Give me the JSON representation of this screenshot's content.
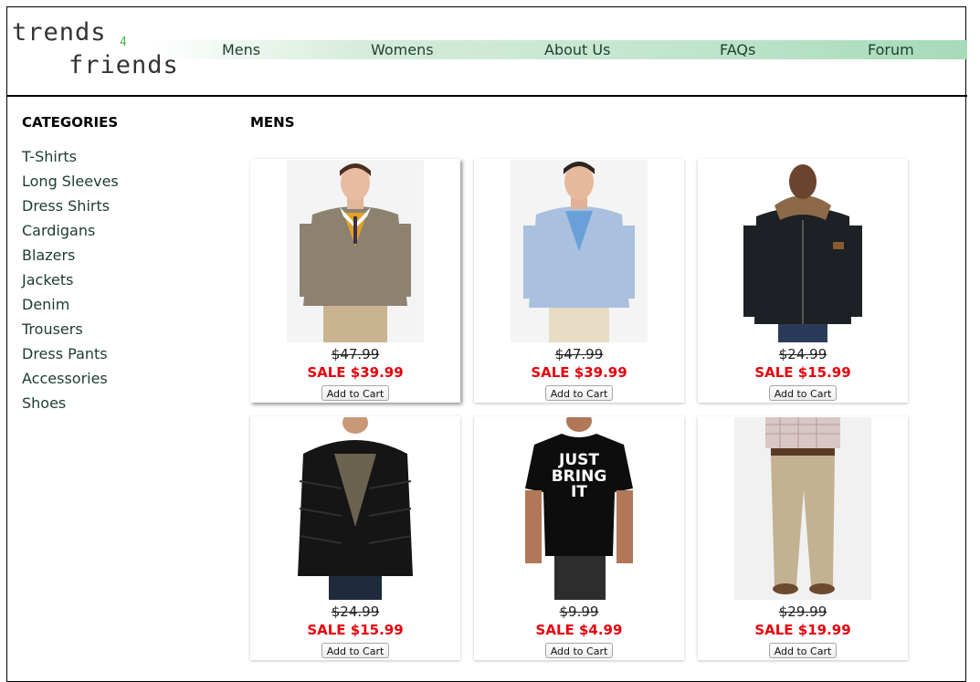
{
  "brand": {
    "line1": "trends",
    "line2": "4",
    "line3": "friends"
  },
  "nav": {
    "items": [
      "Mens",
      "Womens",
      "About Us",
      "FAQs",
      "Forum"
    ]
  },
  "sidebar": {
    "title": "CATEGORIES",
    "items": [
      "T-Shirts",
      "Long Sleeves",
      "Dress Shirts",
      "Cardigans",
      "Blazers",
      "Jackets",
      "Denim",
      "Trousers",
      "Dress Pants",
      "Accessories",
      "Shoes"
    ]
  },
  "main": {
    "title": "MENS",
    "add_to_cart_label": "Add to Cart",
    "products": [
      {
        "image": "tweed-blazer-yellow-sweater",
        "old_price": "$47.99",
        "sale_price": "SALE $39.99"
      },
      {
        "image": "light-blue-blazer",
        "old_price": "$47.99",
        "sale_price": "SALE $39.99"
      },
      {
        "image": "black-parka-fur-hood",
        "old_price": "$24.99",
        "sale_price": "SALE $15.99"
      },
      {
        "image": "black-puffer-jacket",
        "old_price": "$24.99",
        "sale_price": "SALE $15.99"
      },
      {
        "image": "black-tshirt-just-bring-it",
        "old_price": "$9.99",
        "sale_price": "SALE $4.99"
      },
      {
        "image": "khaki-trousers",
        "old_price": "$29.99",
        "sale_price": "SALE $19.99"
      }
    ],
    "tshirt_print": [
      "JUST",
      "BRING",
      "IT"
    ]
  },
  "colors": {
    "sale": "#e8000b",
    "nav_gradient_end": "#a6dab9",
    "logo_accent": "#4caf50"
  }
}
